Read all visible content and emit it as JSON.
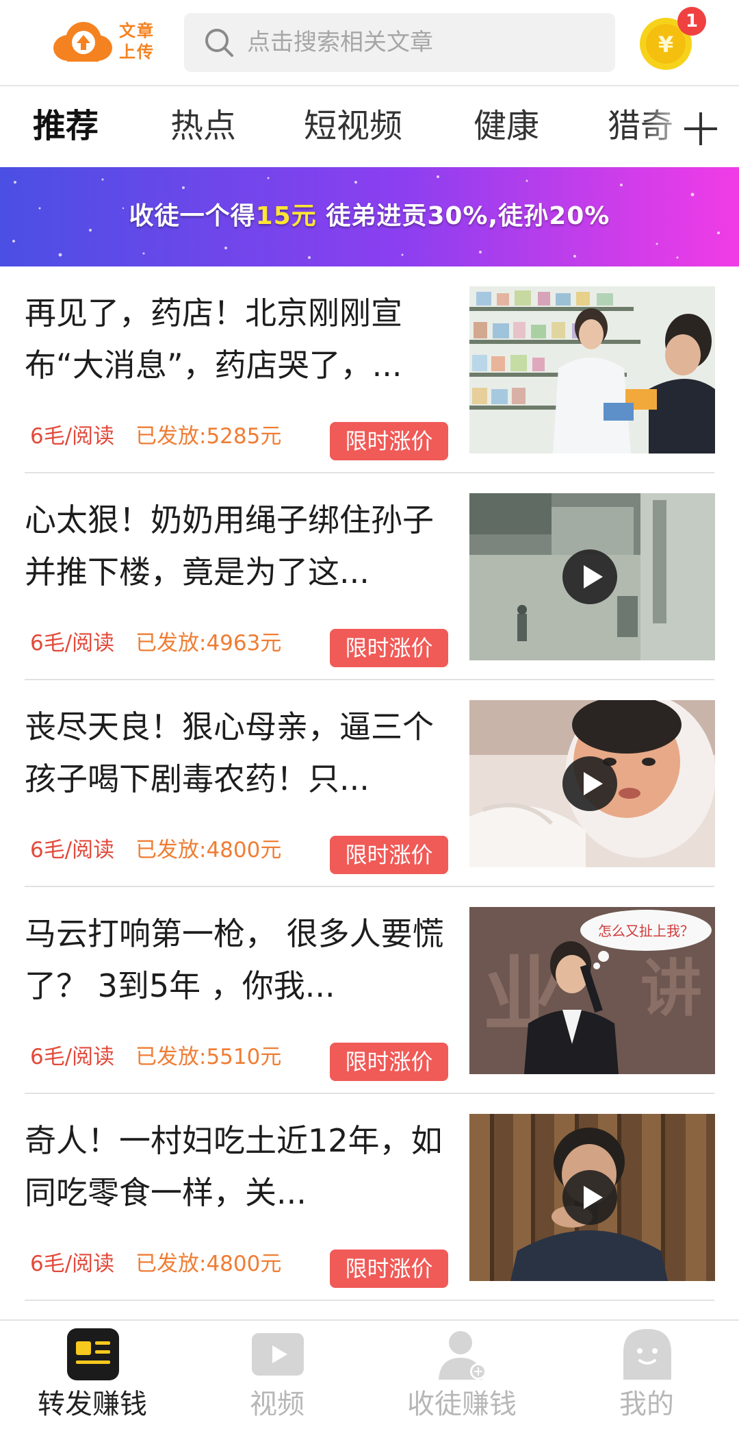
{
  "header": {
    "logo_text": "文章上传",
    "search_placeholder": "点击搜索相关文章",
    "coin_badge": "1",
    "colors": {
      "brand": "#f58220",
      "badge": "#f04141"
    }
  },
  "tabs": [
    {
      "label": "推荐",
      "active": true
    },
    {
      "label": "热点",
      "active": false
    },
    {
      "label": "短视频",
      "active": false
    },
    {
      "label": "健康",
      "active": false
    },
    {
      "label": "猎奇",
      "active": false
    }
  ],
  "banner": {
    "part1": "收徒一个得",
    "highlight": "15元",
    "part2": " 徒弟进贡30%,徒孙20%"
  },
  "articles": [
    {
      "title": "再见了，药店！北京刚刚宣布“大消息”，药店哭了，...",
      "rate": "6毛/阅读",
      "paid": "已发放:5285元",
      "tag": "限时涨价",
      "thumb": "pharmacy-photo",
      "video": false
    },
    {
      "title": "心太狠！奶奶用绳子绑住孙子并推下楼，竟是为了这...",
      "rate": "6毛/阅读",
      "paid": "已发放:4963元",
      "tag": "限时涨价",
      "thumb": "cctv-street-photo",
      "video": true
    },
    {
      "title": "丧尽天良！狠心母亲，逼三个孩子喝下剧毒农药！只...",
      "rate": "6毛/阅读",
      "paid": "已发放:4800元",
      "tag": "限时涨价",
      "thumb": "hospital-child-photo",
      "video": true
    },
    {
      "title": "马云打响第一枪， 很多人要慌了？ 3到5年 ，你我...",
      "rate": "6毛/阅读",
      "paid": "已发放:5510元",
      "tag": "限时涨价",
      "thumb": "speaker-photo",
      "thumb_caption": "怎么又扯上我？",
      "video": false
    },
    {
      "title": "奇人！一村妇吃土近12年，如同吃零食一样，关...",
      "rate": "6毛/阅读",
      "paid": "已发放:4800元",
      "tag": "限时涨价",
      "thumb": "woman-wood-wall-photo",
      "video": true
    }
  ],
  "bottom_nav": [
    {
      "label": "转发赚钱",
      "icon": "article-icon",
      "active": true
    },
    {
      "label": "视频",
      "icon": "video-icon",
      "active": false
    },
    {
      "label": "收徒赚钱",
      "icon": "add-user-icon",
      "active": false
    },
    {
      "label": "我的",
      "icon": "profile-icon",
      "active": false
    }
  ]
}
